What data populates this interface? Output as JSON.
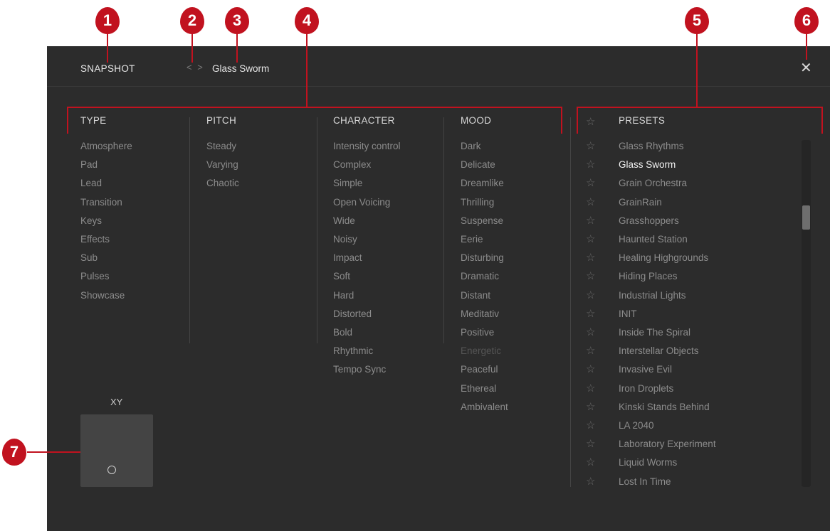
{
  "header": {
    "snapshot_label": "SNAPSHOT",
    "nav_arrows": "< >",
    "preset_name": "Glass Sworm",
    "close_glyph": "✕"
  },
  "filters": {
    "type": {
      "title": "TYPE",
      "items": [
        "Atmosphere",
        "Pad",
        "Lead",
        "Transition",
        "Keys",
        "Effects",
        "Sub",
        "Pulses",
        "Showcase"
      ]
    },
    "pitch": {
      "title": "PITCH",
      "items": [
        "Steady",
        "Varying",
        "Chaotic"
      ]
    },
    "character": {
      "title": "CHARACTER",
      "items": [
        "Intensity control",
        "Complex",
        "Simple",
        "Open Voicing",
        "Wide",
        "Noisy",
        "Impact",
        "Soft",
        "Hard",
        "Distorted",
        "Bold",
        "Rhythmic",
        "Tempo Sync"
      ]
    },
    "mood": {
      "title": "MOOD",
      "items": [
        "Dark",
        "Delicate",
        "Dreamlike",
        "Thrilling",
        "Suspense",
        "Eerie",
        "Disturbing",
        "Dramatic",
        "Distant",
        "Meditativ",
        "Positive",
        "Energetic",
        "Peaceful",
        "Ethereal",
        "Ambivalent"
      ]
    }
  },
  "presets": {
    "title": "PRESETS",
    "selected": "Glass Sworm",
    "items": [
      "Glass Rhythms",
      "Glass Sworm",
      "Grain Orchestra",
      "GrainRain",
      "Grasshoppers",
      "Haunted Station",
      "Healing Highgrounds",
      "Hiding Places",
      "Industrial Lights",
      "INIT",
      "Inside The Spiral",
      "Interstellar Objects",
      "Invasive Evil",
      "Iron Droplets",
      "Kinski Stands Behind",
      "LA 2040",
      "Laboratory Experiment",
      "Liquid Worms",
      "Lost In Time"
    ]
  },
  "xy": {
    "label": "XY"
  },
  "callouts": [
    "1",
    "2",
    "3",
    "4",
    "5",
    "6",
    "7"
  ],
  "colors": {
    "callout": "#c1121f",
    "panel_bg": "#2c2c2c"
  }
}
